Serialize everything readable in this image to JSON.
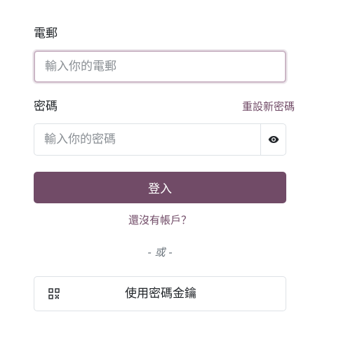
{
  "email": {
    "label": "電郵",
    "placeholder": "輸入你的電郵"
  },
  "password": {
    "label": "密碼",
    "reset_link": "重設新密碼",
    "placeholder": "輸入你的密碼",
    "toggle_icon": "eye-icon"
  },
  "login_button": "登入",
  "signup_link": "還沒有帳戶？",
  "or_divider": "- 或 -",
  "passkey": {
    "label": "使用密碼金鑰",
    "icon": "qr-code-icon"
  },
  "colors": {
    "primary": "#714B67",
    "border": "#dee2e6",
    "focus_border": "#cbb6c6",
    "muted_text": "#6c757d"
  }
}
